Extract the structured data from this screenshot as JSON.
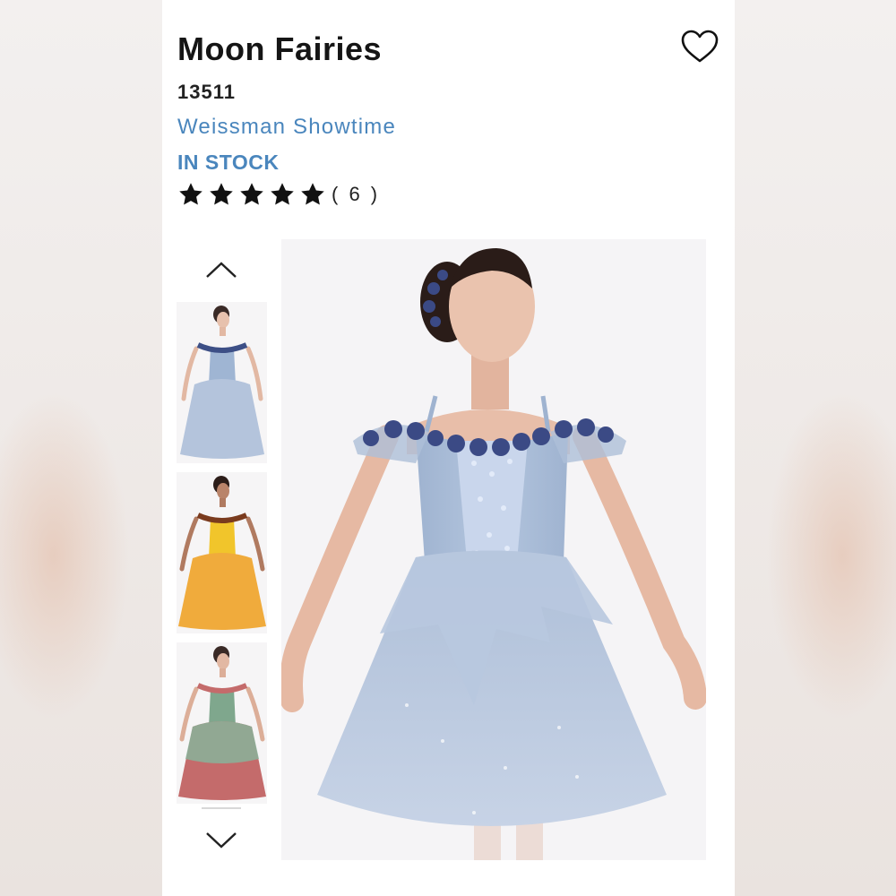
{
  "product": {
    "title": "Moon Fairies",
    "sku": "13511",
    "brand": "Weissman Showtime",
    "stock_status": "IN STOCK",
    "rating": {
      "stars": 5,
      "max": 5,
      "review_count_label": "( 6 )"
    }
  },
  "icons": {
    "favorite": "heart-outline-icon",
    "gallery_up": "chevron-up-icon",
    "gallery_down": "chevron-down-icon",
    "star": "star-filled-icon"
  },
  "gallery": {
    "thumbnails": [
      {
        "color_name": "blue",
        "dress_color": "#a9bcd6",
        "accent": "#3d4f86"
      },
      {
        "color_name": "yellow",
        "dress_color": "#f0ab3c",
        "accent": "#7a3b1e"
      },
      {
        "color_name": "green-pink",
        "dress_color": "#88b39a",
        "accent": "#c46b6b"
      }
    ],
    "selected_index": 0
  },
  "colors": {
    "brand_blue": "#4a86bd",
    "text_dark": "#151515",
    "dress_blue": "#a9bcd6",
    "flower_navy": "#3b4a85"
  }
}
